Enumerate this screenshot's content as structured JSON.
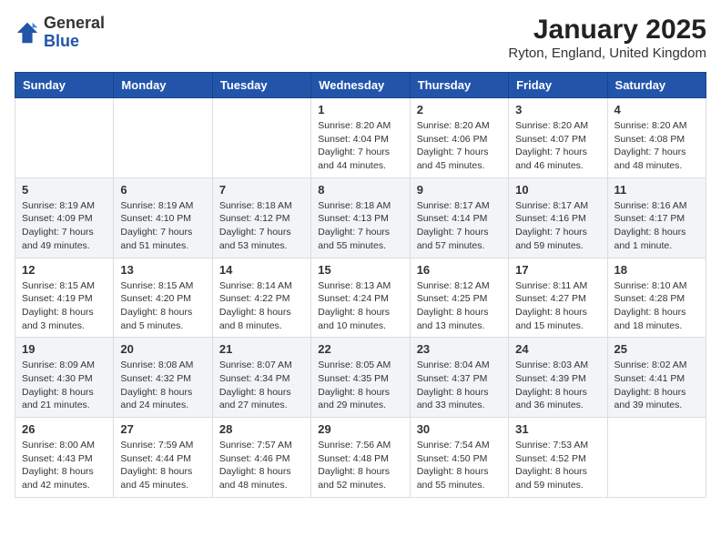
{
  "header": {
    "logo_general": "General",
    "logo_blue": "Blue",
    "month_title": "January 2025",
    "location": "Ryton, England, United Kingdom"
  },
  "days_of_week": [
    "Sunday",
    "Monday",
    "Tuesday",
    "Wednesday",
    "Thursday",
    "Friday",
    "Saturday"
  ],
  "weeks": [
    [
      {
        "day": "",
        "sunrise": "",
        "sunset": "",
        "daylight": ""
      },
      {
        "day": "",
        "sunrise": "",
        "sunset": "",
        "daylight": ""
      },
      {
        "day": "",
        "sunrise": "",
        "sunset": "",
        "daylight": ""
      },
      {
        "day": "1",
        "sunrise": "Sunrise: 8:20 AM",
        "sunset": "Sunset: 4:04 PM",
        "daylight": "Daylight: 7 hours and 44 minutes."
      },
      {
        "day": "2",
        "sunrise": "Sunrise: 8:20 AM",
        "sunset": "Sunset: 4:06 PM",
        "daylight": "Daylight: 7 hours and 45 minutes."
      },
      {
        "day": "3",
        "sunrise": "Sunrise: 8:20 AM",
        "sunset": "Sunset: 4:07 PM",
        "daylight": "Daylight: 7 hours and 46 minutes."
      },
      {
        "day": "4",
        "sunrise": "Sunrise: 8:20 AM",
        "sunset": "Sunset: 4:08 PM",
        "daylight": "Daylight: 7 hours and 48 minutes."
      }
    ],
    [
      {
        "day": "5",
        "sunrise": "Sunrise: 8:19 AM",
        "sunset": "Sunset: 4:09 PM",
        "daylight": "Daylight: 7 hours and 49 minutes."
      },
      {
        "day": "6",
        "sunrise": "Sunrise: 8:19 AM",
        "sunset": "Sunset: 4:10 PM",
        "daylight": "Daylight: 7 hours and 51 minutes."
      },
      {
        "day": "7",
        "sunrise": "Sunrise: 8:18 AM",
        "sunset": "Sunset: 4:12 PM",
        "daylight": "Daylight: 7 hours and 53 minutes."
      },
      {
        "day": "8",
        "sunrise": "Sunrise: 8:18 AM",
        "sunset": "Sunset: 4:13 PM",
        "daylight": "Daylight: 7 hours and 55 minutes."
      },
      {
        "day": "9",
        "sunrise": "Sunrise: 8:17 AM",
        "sunset": "Sunset: 4:14 PM",
        "daylight": "Daylight: 7 hours and 57 minutes."
      },
      {
        "day": "10",
        "sunrise": "Sunrise: 8:17 AM",
        "sunset": "Sunset: 4:16 PM",
        "daylight": "Daylight: 7 hours and 59 minutes."
      },
      {
        "day": "11",
        "sunrise": "Sunrise: 8:16 AM",
        "sunset": "Sunset: 4:17 PM",
        "daylight": "Daylight: 8 hours and 1 minute."
      }
    ],
    [
      {
        "day": "12",
        "sunrise": "Sunrise: 8:15 AM",
        "sunset": "Sunset: 4:19 PM",
        "daylight": "Daylight: 8 hours and 3 minutes."
      },
      {
        "day": "13",
        "sunrise": "Sunrise: 8:15 AM",
        "sunset": "Sunset: 4:20 PM",
        "daylight": "Daylight: 8 hours and 5 minutes."
      },
      {
        "day": "14",
        "sunrise": "Sunrise: 8:14 AM",
        "sunset": "Sunset: 4:22 PM",
        "daylight": "Daylight: 8 hours and 8 minutes."
      },
      {
        "day": "15",
        "sunrise": "Sunrise: 8:13 AM",
        "sunset": "Sunset: 4:24 PM",
        "daylight": "Daylight: 8 hours and 10 minutes."
      },
      {
        "day": "16",
        "sunrise": "Sunrise: 8:12 AM",
        "sunset": "Sunset: 4:25 PM",
        "daylight": "Daylight: 8 hours and 13 minutes."
      },
      {
        "day": "17",
        "sunrise": "Sunrise: 8:11 AM",
        "sunset": "Sunset: 4:27 PM",
        "daylight": "Daylight: 8 hours and 15 minutes."
      },
      {
        "day": "18",
        "sunrise": "Sunrise: 8:10 AM",
        "sunset": "Sunset: 4:28 PM",
        "daylight": "Daylight: 8 hours and 18 minutes."
      }
    ],
    [
      {
        "day": "19",
        "sunrise": "Sunrise: 8:09 AM",
        "sunset": "Sunset: 4:30 PM",
        "daylight": "Daylight: 8 hours and 21 minutes."
      },
      {
        "day": "20",
        "sunrise": "Sunrise: 8:08 AM",
        "sunset": "Sunset: 4:32 PM",
        "daylight": "Daylight: 8 hours and 24 minutes."
      },
      {
        "day": "21",
        "sunrise": "Sunrise: 8:07 AM",
        "sunset": "Sunset: 4:34 PM",
        "daylight": "Daylight: 8 hours and 27 minutes."
      },
      {
        "day": "22",
        "sunrise": "Sunrise: 8:05 AM",
        "sunset": "Sunset: 4:35 PM",
        "daylight": "Daylight: 8 hours and 29 minutes."
      },
      {
        "day": "23",
        "sunrise": "Sunrise: 8:04 AM",
        "sunset": "Sunset: 4:37 PM",
        "daylight": "Daylight: 8 hours and 33 minutes."
      },
      {
        "day": "24",
        "sunrise": "Sunrise: 8:03 AM",
        "sunset": "Sunset: 4:39 PM",
        "daylight": "Daylight: 8 hours and 36 minutes."
      },
      {
        "day": "25",
        "sunrise": "Sunrise: 8:02 AM",
        "sunset": "Sunset: 4:41 PM",
        "daylight": "Daylight: 8 hours and 39 minutes."
      }
    ],
    [
      {
        "day": "26",
        "sunrise": "Sunrise: 8:00 AM",
        "sunset": "Sunset: 4:43 PM",
        "daylight": "Daylight: 8 hours and 42 minutes."
      },
      {
        "day": "27",
        "sunrise": "Sunrise: 7:59 AM",
        "sunset": "Sunset: 4:44 PM",
        "daylight": "Daylight: 8 hours and 45 minutes."
      },
      {
        "day": "28",
        "sunrise": "Sunrise: 7:57 AM",
        "sunset": "Sunset: 4:46 PM",
        "daylight": "Daylight: 8 hours and 48 minutes."
      },
      {
        "day": "29",
        "sunrise": "Sunrise: 7:56 AM",
        "sunset": "Sunset: 4:48 PM",
        "daylight": "Daylight: 8 hours and 52 minutes."
      },
      {
        "day": "30",
        "sunrise": "Sunrise: 7:54 AM",
        "sunset": "Sunset: 4:50 PM",
        "daylight": "Daylight: 8 hours and 55 minutes."
      },
      {
        "day": "31",
        "sunrise": "Sunrise: 7:53 AM",
        "sunset": "Sunset: 4:52 PM",
        "daylight": "Daylight: 8 hours and 59 minutes."
      },
      {
        "day": "",
        "sunrise": "",
        "sunset": "",
        "daylight": ""
      }
    ]
  ]
}
